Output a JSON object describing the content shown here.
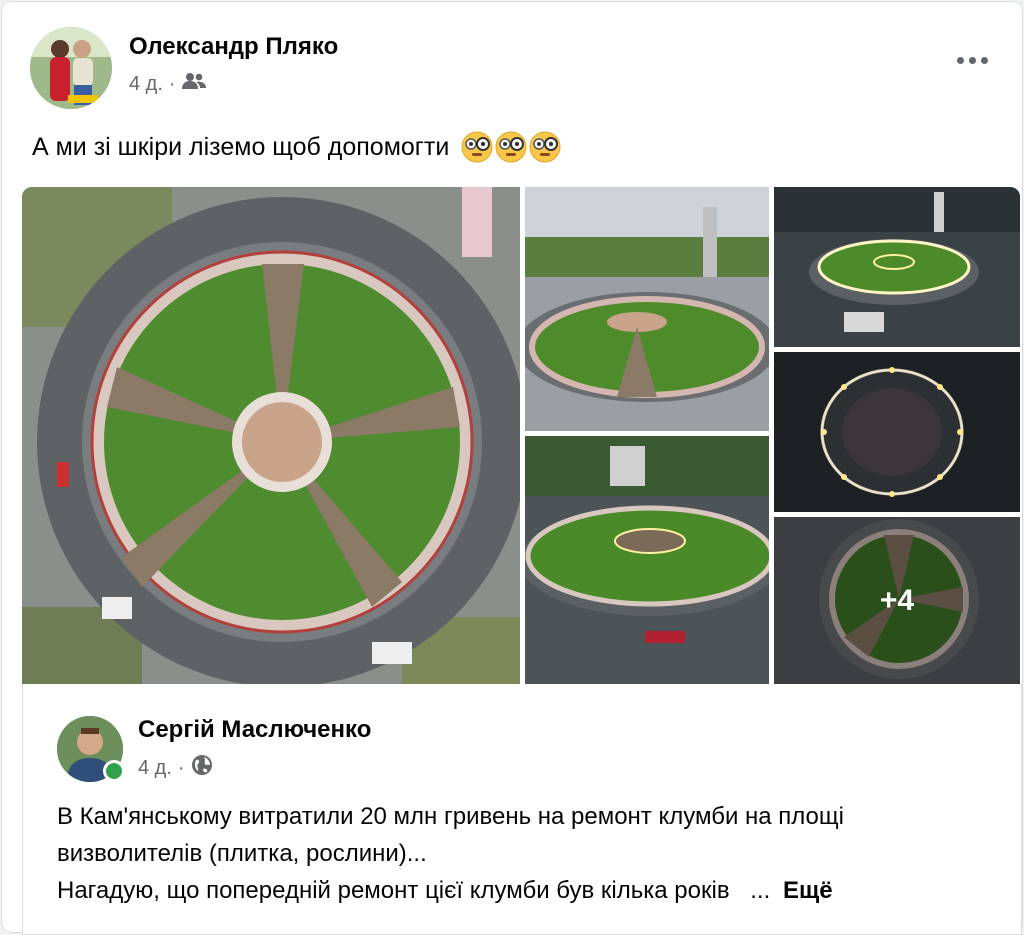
{
  "post": {
    "author": "Олександр Пляко",
    "time": "4 д.",
    "separator": "·",
    "audience_icon": "friends-icon",
    "text": "А ми зі шкіри ліземо щоб допомогти",
    "emoji": [
      "flushed-face-monocle",
      "flushed-face-monocle",
      "flushed-face-monocle"
    ]
  },
  "gallery": {
    "more_count": "+4"
  },
  "shared": {
    "author": "Сергій Маслюченко",
    "time": "4 д.",
    "separator": "·",
    "audience_icon": "globe-icon",
    "lines": [
      "В Кам'янському витратили 20 млн гривень на ремонт клумби на площі",
      "визволителів (плитка, рослини)...",
      "Нагадую, що попередній ремонт цієї клумби був кілька років"
    ],
    "ellipsis": "...",
    "see_more": "Ещё"
  }
}
